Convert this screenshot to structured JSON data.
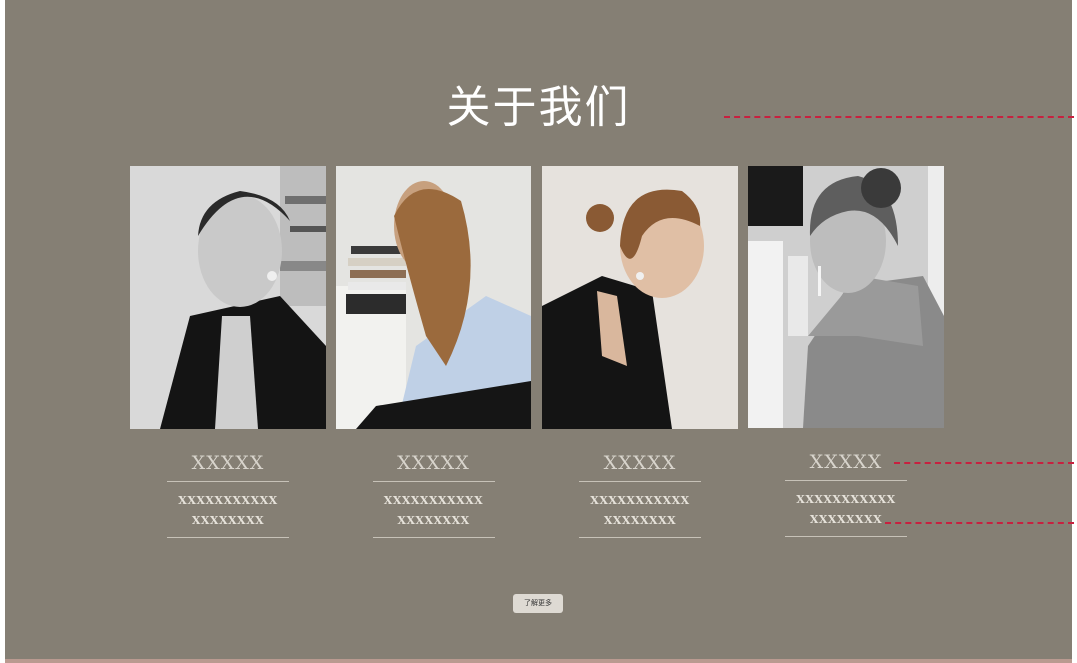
{
  "header": {
    "title": "关于我们"
  },
  "members": [
    {
      "name": "XXXXX",
      "line1": "XXXXXXXXXXX",
      "line2": "XXXXXXXX",
      "photo": "portrait-bw-woman"
    },
    {
      "name": "XXXXX",
      "line1": "XXXXXXXXXXX",
      "line2": "XXXXXXXX",
      "photo": "woman-blue-shirt-profile"
    },
    {
      "name": "XXXXX",
      "line1": "XXXXXXXXXXX",
      "line2": "XXXXXXXX",
      "photo": "woman-black-blazer-profile"
    },
    {
      "name": "XXXXX",
      "line1": "XXXXXXXXXXX",
      "line2": "XXXXXXXX",
      "photo": "woman-grey-sweater-back"
    }
  ],
  "cta": {
    "label": "了解更多"
  },
  "colors": {
    "background": "#857f74",
    "guide": "#c8203f",
    "text": "#ffffff"
  }
}
